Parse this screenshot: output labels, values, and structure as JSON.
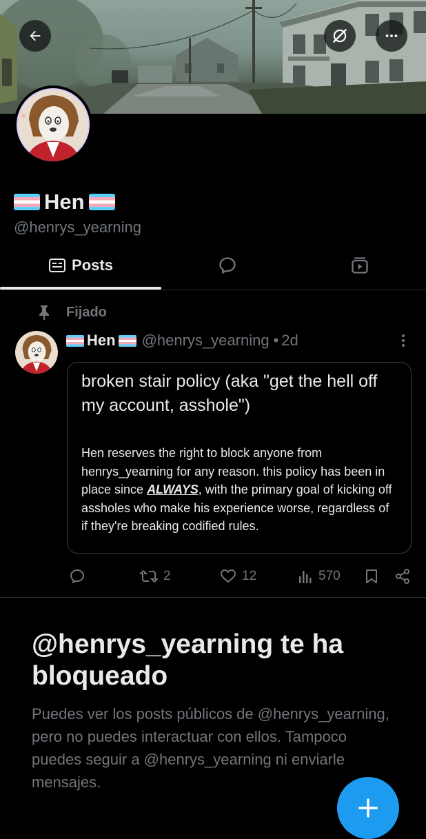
{
  "profile": {
    "display_name": "Hen",
    "handle": "@henrys_yearning",
    "flag": "transgender-flag-emoji"
  },
  "tabs": [
    {
      "label": "Posts",
      "icon": "posts-icon",
      "active": true
    },
    {
      "label": "",
      "icon": "replies-icon",
      "active": false
    },
    {
      "label": "",
      "icon": "media-icon",
      "active": false
    }
  ],
  "post": {
    "pinned_label": "Fijado",
    "author_name": "Hen",
    "author_handle": "@henrys_yearning",
    "time": "2d",
    "separator": "•",
    "card_title": "broken stair policy (aka \"get the hell off my account, asshole\")",
    "card_body_before": "Hen reserves the right to block anyone from henrys_yearning for any reason. this policy has been in place since ",
    "card_body_emphasis": "ALWAYS",
    "card_body_after": ", with the primary goal of kicking off assholes who make his experience worse, regardless of if they're breaking codified rules.",
    "reposts": "2",
    "likes": "12",
    "views": "570"
  },
  "blocked": {
    "title": "@henrys_yearning te ha bloqueado",
    "description": "Puedes ver los posts públicos de @henrys_yearning, pero no puedes interactuar con ellos. Tampoco puedes seguir a @henrys_yearning ni enviarle mensajes."
  },
  "colors": {
    "background": "#000000",
    "text_primary": "#e7e9ea",
    "text_secondary": "#71767b",
    "accent": "#1d9bf0",
    "divider": "#2f3336"
  }
}
